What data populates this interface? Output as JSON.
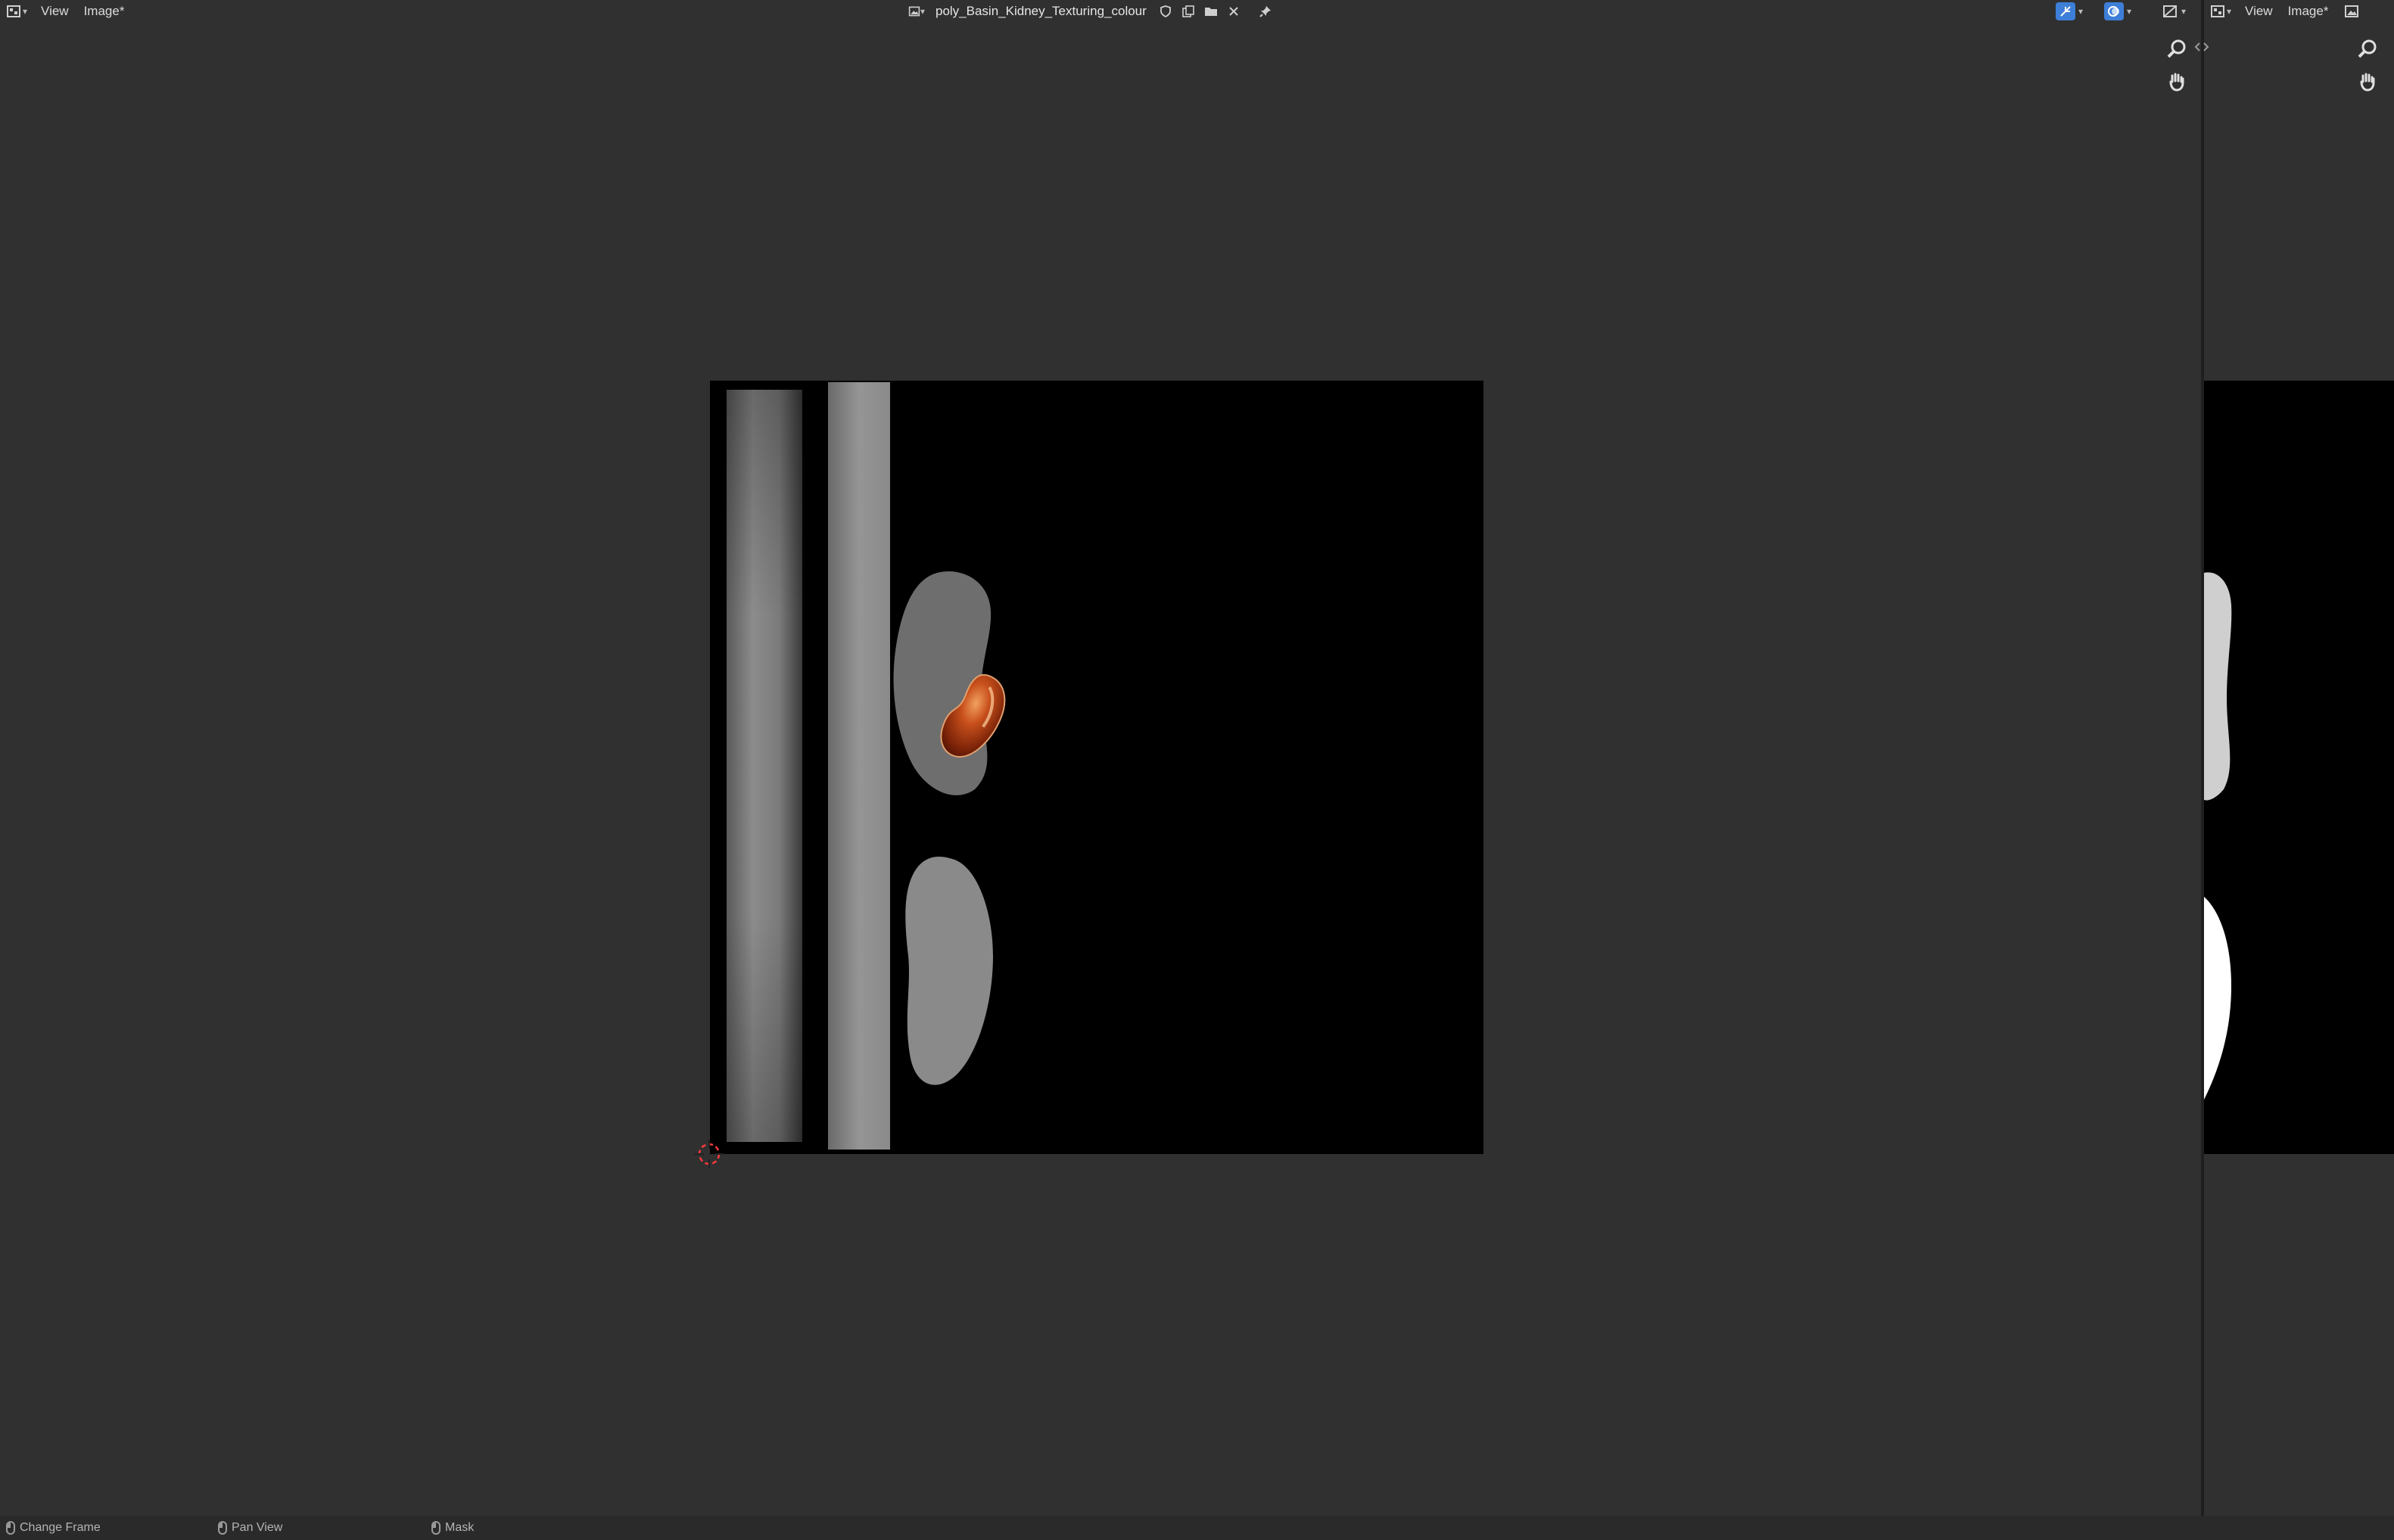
{
  "left_editor": {
    "menus": [
      "View",
      "Image*"
    ],
    "image_name": "poly_Basin_Kidney_Texturing_colour"
  },
  "right_editor": {
    "menus": [
      "View",
      "Image*"
    ]
  },
  "status_bar": {
    "items": [
      "Change Frame",
      "Pan View",
      "Mask"
    ]
  },
  "colors": {
    "background": "#303030",
    "canvas": "#000000",
    "accent": "#3d7fd8"
  },
  "icons": {
    "editor_type": "image-editor-icon",
    "zoom": "zoom-icon",
    "pan": "hand-icon",
    "pin": "pin-icon",
    "close": "close-icon"
  }
}
